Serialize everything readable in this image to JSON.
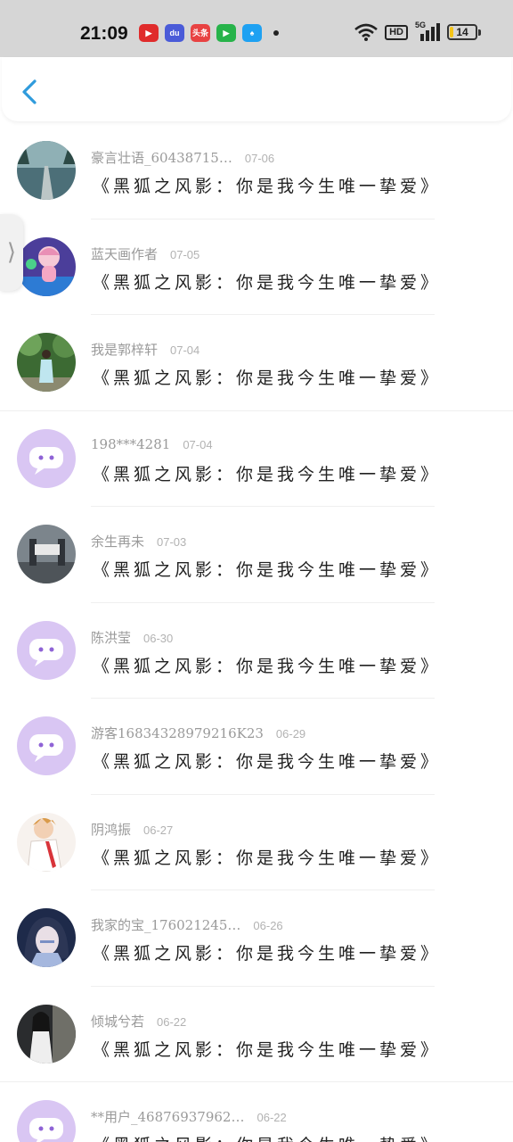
{
  "status_bar": {
    "time": "21:09",
    "notifications": [
      {
        "name": "video-app-icon",
        "color": "#e02b2b",
        "glyph": "▶"
      },
      {
        "name": "baidu-app-icon",
        "color": "#4a5bd8",
        "glyph": "du"
      },
      {
        "name": "toutiao-app-icon",
        "color": "#e84242",
        "glyph": "头条"
      },
      {
        "name": "iqiyi-app-icon",
        "color": "#27b34a",
        "glyph": "▶"
      },
      {
        "name": "qq-app-icon",
        "color": "#1ea1f2",
        "glyph": "♠"
      }
    ],
    "hd_label": "HD",
    "network_label": "5G",
    "battery_level": "14",
    "battery_fraction": 0.14
  },
  "nav": {
    "back_icon": "chevron-left-icon",
    "accent_color": "#2f9bdc"
  },
  "edge_handle": {
    "glyph": "⟩"
  },
  "comments": [
    {
      "user": "豪言壮语_60438715…",
      "date": "07-06",
      "message": "《黑狐之风影：你是我今生唯一挚爱》",
      "avatar": "photo-road"
    },
    {
      "user": "蓝天画作者",
      "date": "07-05",
      "message": "《黑狐之风影：你是我今生唯一挚爱》",
      "avatar": "photo-cartoon"
    },
    {
      "user": "我是郭梓轩",
      "date": "07-04",
      "message": "《黑狐之风影：你是我今生唯一挚爱》",
      "avatar": "photo-person"
    },
    {
      "user": "198***4281",
      "date": "07-04",
      "message": "《黑狐之风影：你是我今生唯一挚爱》",
      "avatar": "default"
    },
    {
      "user": "余生再未",
      "date": "07-03",
      "message": "《黑狐之风影：你是我今生唯一挚爱》",
      "avatar": "photo-building"
    },
    {
      "user": "陈洪莹",
      "date": "06-30",
      "message": "《黑狐之风影：你是我今生唯一挚爱》",
      "avatar": "default"
    },
    {
      "user": "游客16834328979216K23",
      "date": "06-29",
      "message": "《黑狐之风影：你是我今生唯一挚爱》",
      "avatar": "default"
    },
    {
      "user": "阴鸿振",
      "date": "06-27",
      "message": "《黑狐之风影：你是我今生唯一挚爱》",
      "avatar": "photo-anime-boy"
    },
    {
      "user": "我家的宝_176021245…",
      "date": "06-26",
      "message": "《黑狐之风影：你是我今生唯一挚爱》",
      "avatar": "photo-anime-girl"
    },
    {
      "user": "倾城兮若",
      "date": "06-22",
      "message": "《黑狐之风影：你是我今生唯一挚爱》",
      "avatar": "photo-dark"
    },
    {
      "user": "**用户_46876937962…",
      "date": "06-22",
      "message": "《黑狐之风影：你是我今生唯一挚爱》",
      "avatar": "default"
    }
  ],
  "colors": {
    "default_avatar_bg": "#d9c6f3",
    "default_avatar_fg": "#8f63d6",
    "username_text": "#9a9a9a",
    "message_text": "#222222"
  }
}
